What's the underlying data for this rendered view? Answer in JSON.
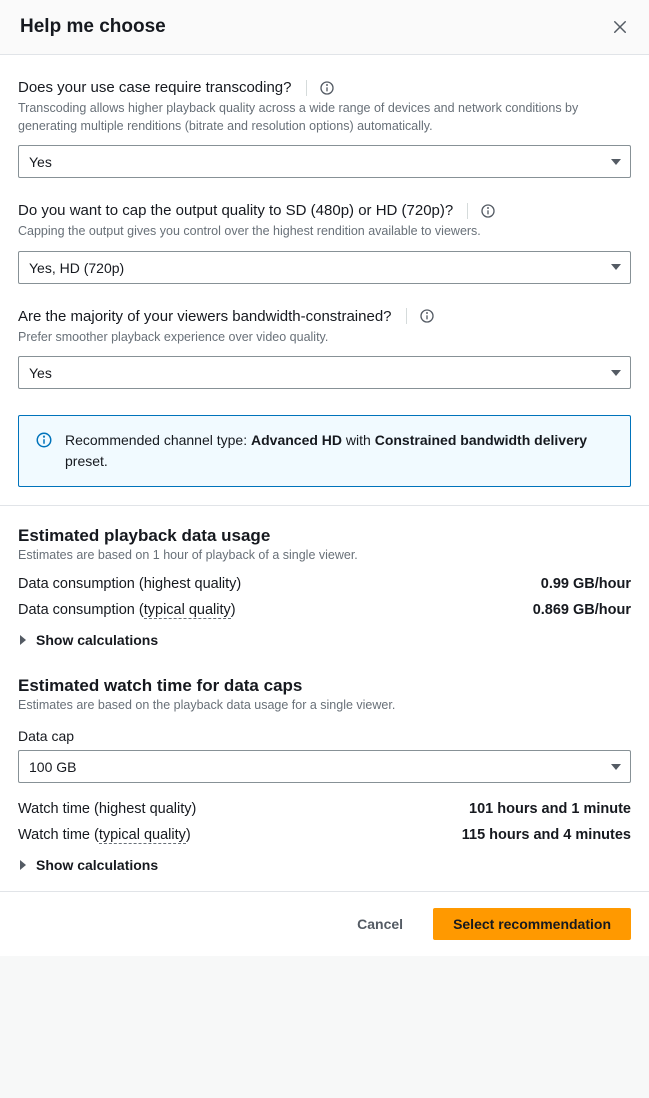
{
  "header": {
    "title": "Help me choose"
  },
  "questions": {
    "transcoding": {
      "label": "Does your use case require transcoding?",
      "hint": "Transcoding allows higher playback quality across a wide range of devices and network conditions by generating multiple renditions (bitrate and resolution options) automatically.",
      "value": "Yes"
    },
    "cap": {
      "label": "Do you want to cap the output quality to SD (480p) or HD (720p)?",
      "hint": "Capping the output gives you control over the highest rendition available to viewers.",
      "value": "Yes, HD (720p)"
    },
    "bandwidth": {
      "label": "Are the majority of your viewers bandwidth-constrained?",
      "hint": "Prefer smoother playback experience over video quality.",
      "value": "Yes"
    }
  },
  "recommend": {
    "prefix": "Recommended channel type: ",
    "type": "Advanced HD",
    "middle": " with ",
    "preset": "Constrained bandwidth delivery",
    "suffix": " preset."
  },
  "usage": {
    "title": "Estimated playback data usage",
    "hint": "Estimates are based on 1 hour of playback of a single viewer.",
    "rows": {
      "highest": {
        "label": "Data consumption (highest quality)",
        "value": "0.99 GB/hour"
      },
      "typical": {
        "prefix": "Data consumption (",
        "dotted": "typical quality",
        "suffix": ")",
        "value": "0.869 GB/hour"
      }
    },
    "expander": "Show calculations"
  },
  "watch": {
    "title": "Estimated watch time for data caps",
    "hint": "Estimates are based on the playback data usage for a single viewer.",
    "datacap_label": "Data cap",
    "datacap_value": "100 GB",
    "rows": {
      "highest": {
        "label": "Watch time (highest quality)",
        "value": "101 hours and 1 minute"
      },
      "typical": {
        "prefix": "Watch time (",
        "dotted": "typical quality",
        "suffix": ")",
        "value": "115 hours and 4 minutes"
      }
    },
    "expander": "Show calculations"
  },
  "footer": {
    "cancel": "Cancel",
    "select": "Select recommendation"
  }
}
